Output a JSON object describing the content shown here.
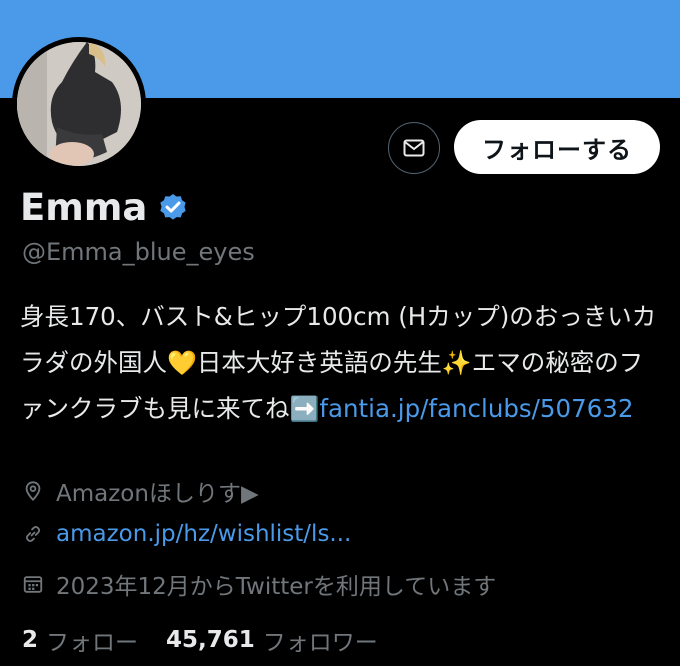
{
  "banner": {
    "color": "#4a9ae9"
  },
  "profile": {
    "name": "Emma",
    "handle": "@Emma_blue_eyes",
    "verified_icon": "verified-badge-icon"
  },
  "actions": {
    "follow_label": "フォローする",
    "message_icon": "envelope-icon"
  },
  "bio": {
    "text_1": "身長170、バスト&ヒップ100cm (Hカップ)のおっきいカラダの外国人",
    "emoji_heart": "💛",
    "text_2": "日本大好き英語の先生",
    "emoji_sparkles": "✨",
    "text_3": "エマの秘密のファンクラブも見に来てね",
    "emoji_arrow": "➡️",
    "link": "fantia.jp/fanclubs/507632"
  },
  "meta": {
    "location": "Amazonほしりす▶",
    "website": "amazon.jp/hz/wishlist/ls...",
    "joined": "2023年12月からTwitterを利用しています"
  },
  "stats": {
    "following_count": "2",
    "following_label": "フォロー",
    "followers_count": "45,761",
    "followers_label": "フォロワー"
  },
  "colors": {
    "accent": "#4a9ae9",
    "muted": "#71767b",
    "text": "#e7e9ea"
  }
}
